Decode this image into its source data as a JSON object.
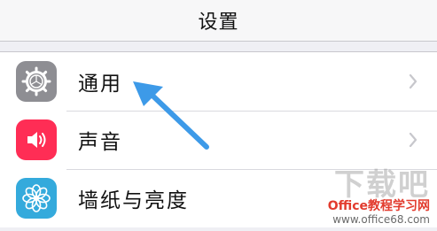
{
  "navbar": {
    "title": "设置"
  },
  "rows": [
    {
      "label": "通用",
      "icon": "gear-icon",
      "color": "#8e8e93"
    },
    {
      "label": "声音",
      "icon": "speaker-icon",
      "color": "#ff2d55"
    },
    {
      "label": "墙纸与亮度",
      "icon": "flower-icon",
      "color": "#34aadc"
    }
  ],
  "arrow_color": "#3d9ae8",
  "watermark": {
    "big": "下载吧",
    "site": "Office教程学习网",
    "url": "www.office68.com"
  }
}
